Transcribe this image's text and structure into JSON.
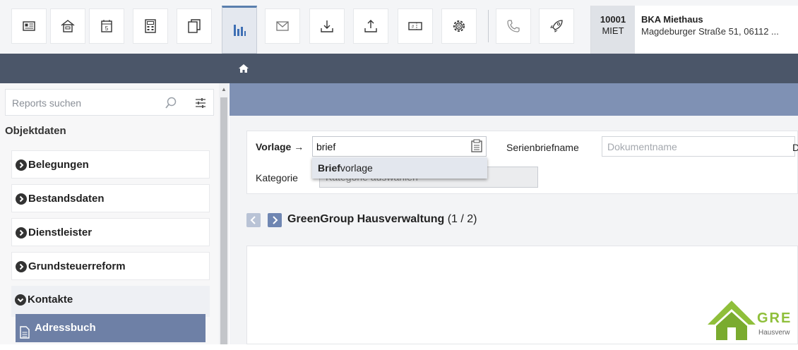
{
  "toolbar": {
    "buttons": [
      {
        "name": "contact-card-icon"
      },
      {
        "name": "house-icon"
      },
      {
        "name": "calendar-icon",
        "text": "5"
      },
      {
        "name": "calculator-icon"
      },
      {
        "name": "documents-icon"
      },
      {
        "name": "reports-icon",
        "active": true
      },
      {
        "name": "mail-icon"
      },
      {
        "name": "download-icon"
      },
      {
        "name": "upload-icon"
      },
      {
        "name": "ticket-icon"
      },
      {
        "name": "settings-icon"
      },
      {
        "name": "phone-icon"
      },
      {
        "name": "rocket-icon"
      }
    ],
    "active_color": "#5a7fae"
  },
  "object": {
    "number": "10001",
    "type": "MIET",
    "title": "BKA Miethaus",
    "address": "Magdeburger Straße 51, 06112 ..."
  },
  "sidebar": {
    "search_placeholder": "Reports suchen",
    "section": "Objektdaten",
    "items": [
      {
        "label": "Belegungen"
      },
      {
        "label": "Bestandsdaten"
      },
      {
        "label": "Dienstleister"
      },
      {
        "label": "Grundsteuerreform"
      },
      {
        "label": "Kontakte"
      },
      {
        "label": "Adressbuch"
      }
    ]
  },
  "form": {
    "vorlage_label": "Vorlage →",
    "vorlage_value": "brief",
    "serienbrief_label": "Serienbriefname",
    "document_placeholder": "Dokumentname",
    "d_label": "D",
    "kategorie_label": "Kategorie",
    "kategorie_placeholder": "Kategorie auswählen",
    "dropdown": {
      "match": "Brief",
      "rest": "vorlage"
    }
  },
  "company": {
    "name": "GreenGroup Hausverwaltung",
    "count": "(1 / 2)"
  },
  "logo": {
    "word": "GRE",
    "sub": "Hausverw",
    "color": "#8fbf3a"
  },
  "colors": {
    "dark_bar": "#4b5669",
    "blue_bar": "#7f91b4",
    "selected_item": "#6e80a6"
  }
}
